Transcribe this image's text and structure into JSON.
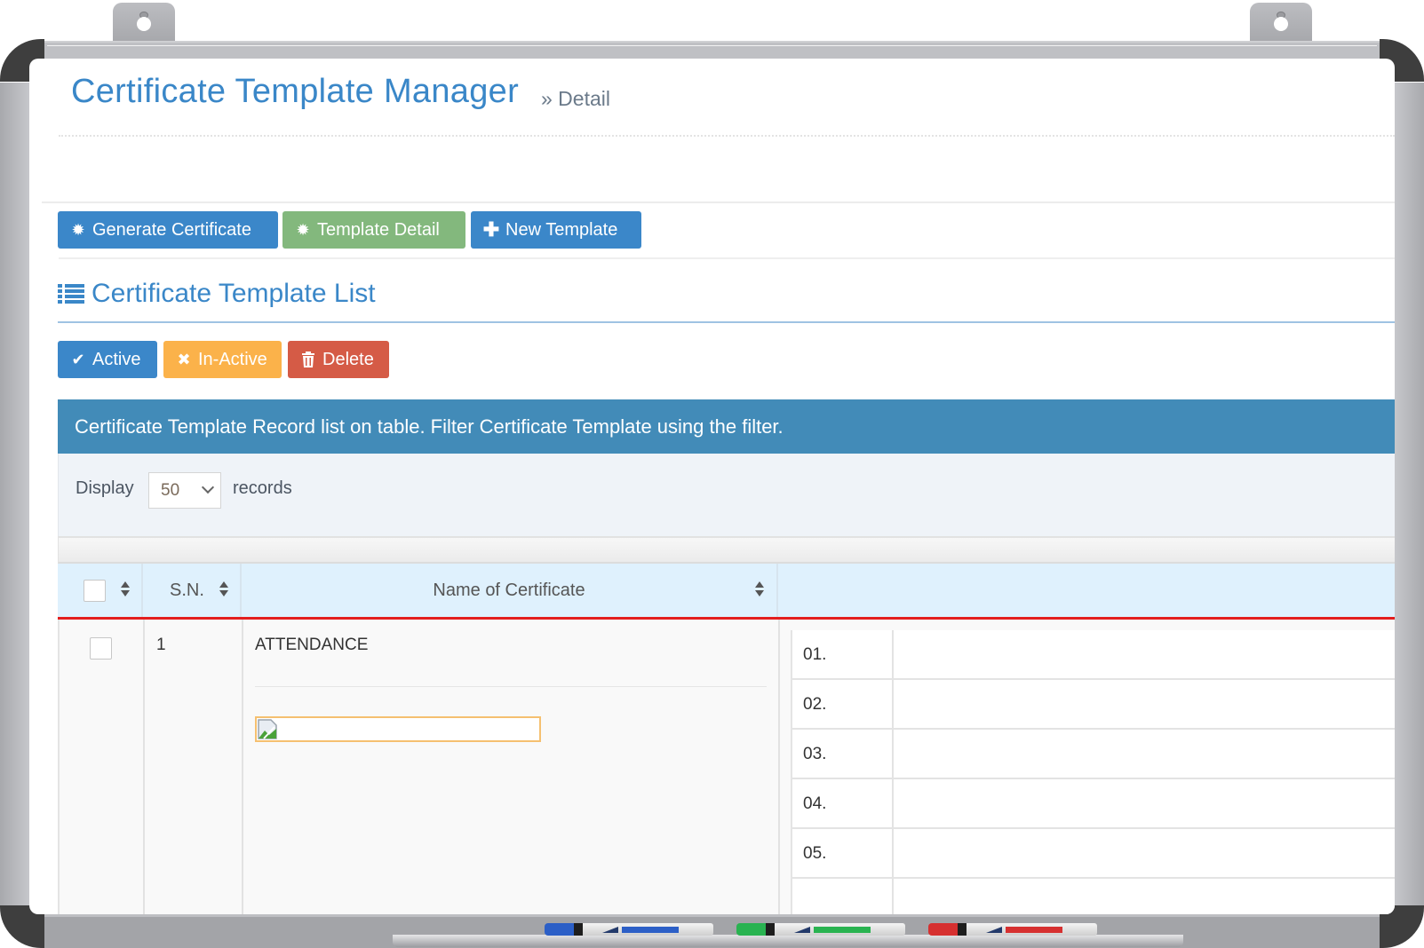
{
  "header": {
    "title": "Certificate Template Manager",
    "breadcrumb": "» Detail"
  },
  "toolbar": {
    "generate_certificate": "Generate Certificate",
    "template_detail": "Template Detail",
    "new_template": "New Template"
  },
  "section": {
    "title": "Certificate Template List"
  },
  "actions": {
    "active": "Active",
    "inactive": "In-Active",
    "delete": "Delete"
  },
  "info_bar": {
    "text": "Certificate Template Record list on table. Filter Certificate Template using the filter."
  },
  "filter": {
    "display_label": "Display",
    "page_size": "50",
    "records_label": "records"
  },
  "table": {
    "columns": [
      "",
      "S.N.",
      "Name of Certificate",
      ""
    ],
    "rows": [
      {
        "sn": "1",
        "name": "ATTENDANCE",
        "sub_items": [
          "01.",
          "02.",
          "03.",
          "04.",
          "05."
        ]
      }
    ]
  },
  "colors": {
    "primary": "#3b87c9",
    "success": "#83b87d",
    "warning": "#fbb24a",
    "danger": "#d55b46",
    "info_bar": "#428bb8",
    "header_red_line": "#e31e1e"
  }
}
